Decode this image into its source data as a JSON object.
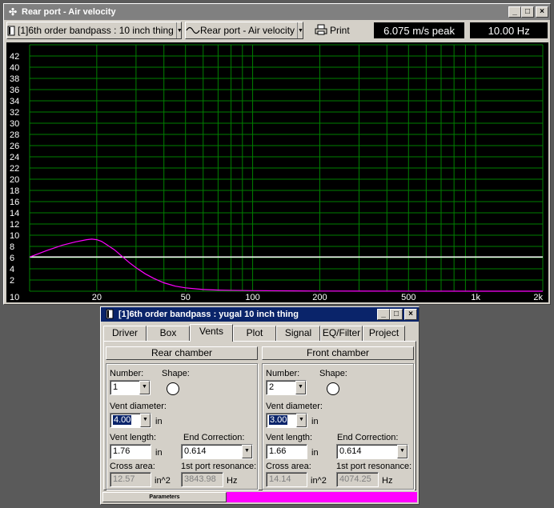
{
  "main_window": {
    "title": "Rear port - Air velocity",
    "project_combo": "[1]6th order bandpass : 10 inch thing",
    "graph_combo": "Rear port - Air velocity",
    "print_label": "Print",
    "peak_readout": "6.075 m/s peak",
    "freq_readout": "10.00 Hz",
    "icons": {
      "title": "move-cross-icon",
      "project": "document-icon",
      "graph": "sine-wave-icon",
      "print": "printer-icon"
    }
  },
  "chart_data": {
    "type": "line",
    "x_scale": "log",
    "xlim": [
      10,
      2000
    ],
    "ylim": [
      0,
      44
    ],
    "x_tick_labels": [
      "10",
      "20",
      "50",
      "100",
      "200",
      "500",
      "1k",
      "2k"
    ],
    "x_tick_values": [
      10,
      20,
      50,
      100,
      200,
      500,
      1000,
      2000
    ],
    "y_ticks": [
      2,
      4,
      6,
      8,
      10,
      12,
      14,
      16,
      18,
      20,
      22,
      24,
      26,
      28,
      30,
      32,
      34,
      36,
      38,
      40,
      42
    ],
    "grid": true,
    "colors": {
      "background": "#000000",
      "grid": "#008000",
      "reference": "#ffffff",
      "series": "#ff00ff"
    },
    "series": [
      {
        "x": [
          10,
          12,
          14,
          16,
          18,
          19,
          20,
          21,
          22,
          24,
          26,
          28,
          30,
          33,
          36,
          40,
          45,
          50,
          60,
          70,
          80,
          100,
          150,
          200,
          300,
          500,
          1000,
          2000
        ],
        "y": [
          6.1,
          7.3,
          8.2,
          8.8,
          9.2,
          9.3,
          9.2,
          8.9,
          8.4,
          7.4,
          6.2,
          5.1,
          4.2,
          3.1,
          2.3,
          1.5,
          0.9,
          0.6,
          0.3,
          0.2,
          0.15,
          0.1,
          0.05,
          0.03,
          0.02,
          0.01,
          0.0,
          0.0
        ]
      },
      {
        "x": [
          10,
          2000
        ],
        "y": [
          6.1,
          6.1
        ]
      }
    ]
  },
  "params_window": {
    "title": "[1]6th order bandpass : yugal 10 inch thing",
    "tabs": [
      {
        "label": "Driver"
      },
      {
        "label": "Box"
      },
      {
        "label": "Vents"
      },
      {
        "label": "Plot"
      },
      {
        "label": "Signal"
      },
      {
        "label": "EQ/Filter"
      },
      {
        "label": "Project"
      }
    ],
    "active_tab": "Vents",
    "rear": {
      "header": "Rear chamber",
      "number_label": "Number:",
      "number": "1",
      "shape_label": "Shape:",
      "diameter_label": "Vent diameter:",
      "diameter": "4.00",
      "diameter_unit": "in",
      "length_label": "Vent length:",
      "length": "1.76",
      "length_unit": "in",
      "endcorr_label": "End Correction:",
      "endcorr": "0.614",
      "area_label": "Cross area:",
      "area": "12.57",
      "area_unit": "in^2",
      "res_label": "1st port resonance:",
      "res": "3843.98",
      "res_unit": "Hz"
    },
    "front": {
      "header": "Front chamber",
      "number_label": "Number:",
      "number": "2",
      "shape_label": "Shape:",
      "diameter_label": "Vent diameter:",
      "diameter": "3.00",
      "diameter_unit": "in",
      "length_label": "Vent length:",
      "length": "1.66",
      "length_unit": "in",
      "endcorr_label": "End Correction:",
      "endcorr": "0.614",
      "area_label": "Cross area:",
      "area": "14.14",
      "area_unit": "in^2",
      "res_label": "1st port resonance:",
      "res": "4074.25",
      "res_unit": "Hz"
    },
    "status": "Parameters",
    "status_color": "#ff00ff"
  }
}
